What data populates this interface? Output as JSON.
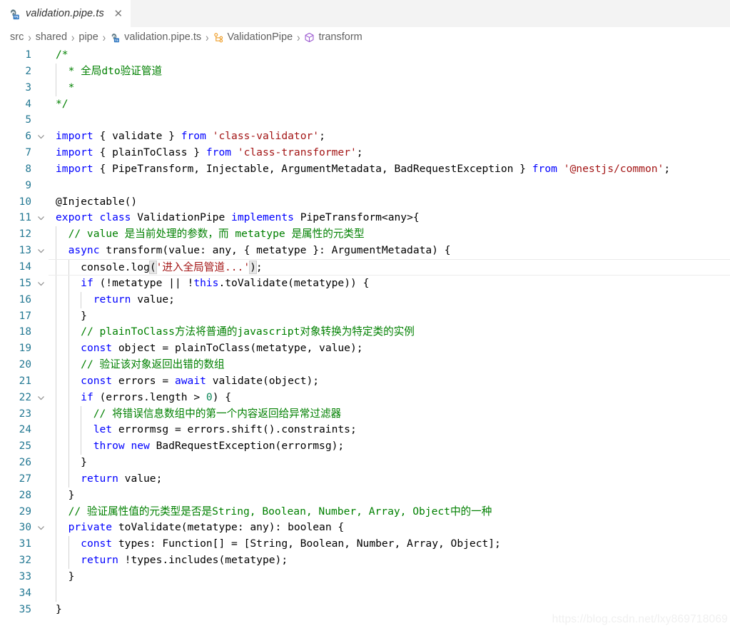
{
  "window": {
    "background": "#ffffff",
    "tabbar_background": "#f3f3f3"
  },
  "tab": {
    "label": "validation.pipe.ts",
    "icon": "nestjs-typescript-file-icon",
    "close_label": "✕",
    "active": true
  },
  "breadcrumb": {
    "separator": "›",
    "items": [
      {
        "label": "src",
        "icon": null
      },
      {
        "label": "shared",
        "icon": null
      },
      {
        "label": "pipe",
        "icon": null
      },
      {
        "label": "validation.pipe.ts",
        "icon": "nestjs-typescript-file-icon"
      },
      {
        "label": "ValidationPipe",
        "icon": "class-symbol-icon"
      },
      {
        "label": "transform",
        "icon": "method-symbol-icon"
      }
    ]
  },
  "editor": {
    "language": "typescript",
    "current_line": 14,
    "colors": {
      "keyword": "#0000ff",
      "string": "#a31515",
      "comment": "#008000",
      "number": "#098658",
      "plain": "#000000",
      "line_number": "#237893",
      "indent_guide": "#d3d3d3",
      "current_line_border": "#ebebeb",
      "bracket_match": "#e7e7e7"
    },
    "lines": [
      {
        "n": 1,
        "fold": false,
        "indent": 0,
        "tokens": [
          {
            "t": "/*",
            "c": "com"
          }
        ]
      },
      {
        "n": 2,
        "fold": false,
        "indent": 1,
        "tokens": [
          {
            "t": "* 全局dto验证管道",
            "c": "com"
          }
        ]
      },
      {
        "n": 3,
        "fold": false,
        "indent": 1,
        "tokens": [
          {
            "t": "*",
            "c": "com"
          }
        ]
      },
      {
        "n": 4,
        "fold": false,
        "indent": 0,
        "tokens": [
          {
            "t": "*/",
            "c": "com"
          }
        ]
      },
      {
        "n": 5,
        "fold": false,
        "indent": 0,
        "tokens": []
      },
      {
        "n": 6,
        "fold": true,
        "indent": 0,
        "tokens": [
          {
            "t": "import",
            "c": "key"
          },
          {
            "t": " { validate } ",
            "c": "plain"
          },
          {
            "t": "from",
            "c": "key"
          },
          {
            "t": " ",
            "c": "plain"
          },
          {
            "t": "'class-validator'",
            "c": "str"
          },
          {
            "t": ";",
            "c": "plain"
          }
        ]
      },
      {
        "n": 7,
        "fold": false,
        "indent": 0,
        "tokens": [
          {
            "t": "import",
            "c": "key"
          },
          {
            "t": " { plainToClass } ",
            "c": "plain"
          },
          {
            "t": "from",
            "c": "key"
          },
          {
            "t": " ",
            "c": "plain"
          },
          {
            "t": "'class-transformer'",
            "c": "str"
          },
          {
            "t": ";",
            "c": "plain"
          }
        ]
      },
      {
        "n": 8,
        "fold": false,
        "indent": 0,
        "tokens": [
          {
            "t": "import",
            "c": "key"
          },
          {
            "t": " { PipeTransform, Injectable, ArgumentMetadata, BadRequestException } ",
            "c": "plain"
          },
          {
            "t": "from",
            "c": "key"
          },
          {
            "t": " ",
            "c": "plain"
          },
          {
            "t": "'@nestjs/common'",
            "c": "str"
          },
          {
            "t": ";",
            "c": "plain"
          }
        ]
      },
      {
        "n": 9,
        "fold": false,
        "indent": 0,
        "tokens": []
      },
      {
        "n": 10,
        "fold": false,
        "indent": 0,
        "tokens": [
          {
            "t": "@Injectable()",
            "c": "plain"
          }
        ]
      },
      {
        "n": 11,
        "fold": true,
        "indent": 0,
        "tokens": [
          {
            "t": "export",
            "c": "key"
          },
          {
            "t": " ",
            "c": "plain"
          },
          {
            "t": "class",
            "c": "key"
          },
          {
            "t": " ValidationPipe ",
            "c": "plain"
          },
          {
            "t": "implements",
            "c": "key"
          },
          {
            "t": " PipeTransform<any>{",
            "c": "plain"
          }
        ]
      },
      {
        "n": 12,
        "fold": false,
        "indent": 1,
        "tokens": [
          {
            "t": "// value 是当前处理的参数，而 metatype 是属性的元类型",
            "c": "com"
          }
        ]
      },
      {
        "n": 13,
        "fold": true,
        "indent": 1,
        "tokens": [
          {
            "t": "async",
            "c": "key"
          },
          {
            "t": " transform(value: any, { metatype }: ArgumentMetadata) {",
            "c": "plain"
          }
        ]
      },
      {
        "n": 14,
        "fold": false,
        "indent": 2,
        "tokens": [
          {
            "t": "console.log",
            "c": "plain"
          },
          {
            "t": "(",
            "c": "plain",
            "hl": true
          },
          {
            "t": "'进入全局管道...'",
            "c": "str"
          },
          {
            "t": ")",
            "c": "plain",
            "hl": true
          },
          {
            "t": ";",
            "c": "plain"
          }
        ]
      },
      {
        "n": 15,
        "fold": true,
        "indent": 2,
        "tokens": [
          {
            "t": "if",
            "c": "key"
          },
          {
            "t": " (!metatype || !",
            "c": "plain"
          },
          {
            "t": "this",
            "c": "key"
          },
          {
            "t": ".toValidate(metatype)) {",
            "c": "plain"
          }
        ]
      },
      {
        "n": 16,
        "fold": false,
        "indent": 3,
        "tokens": [
          {
            "t": "return",
            "c": "key"
          },
          {
            "t": " value;",
            "c": "plain"
          }
        ]
      },
      {
        "n": 17,
        "fold": false,
        "indent": 2,
        "tokens": [
          {
            "t": "}",
            "c": "plain"
          }
        ]
      },
      {
        "n": 18,
        "fold": false,
        "indent": 2,
        "tokens": [
          {
            "t": "// plainToClass方法将普通的javascript对象转换为特定类的实例",
            "c": "com"
          }
        ]
      },
      {
        "n": 19,
        "fold": false,
        "indent": 2,
        "tokens": [
          {
            "t": "const",
            "c": "key"
          },
          {
            "t": " object = plainToClass(metatype, value);",
            "c": "plain"
          }
        ]
      },
      {
        "n": 20,
        "fold": false,
        "indent": 2,
        "tokens": [
          {
            "t": "// 验证该对象返回出错的数组",
            "c": "com"
          }
        ]
      },
      {
        "n": 21,
        "fold": false,
        "indent": 2,
        "tokens": [
          {
            "t": "const",
            "c": "key"
          },
          {
            "t": " errors = ",
            "c": "plain"
          },
          {
            "t": "await",
            "c": "key"
          },
          {
            "t": " validate(object);",
            "c": "plain"
          }
        ]
      },
      {
        "n": 22,
        "fold": true,
        "indent": 2,
        "tokens": [
          {
            "t": "if",
            "c": "key"
          },
          {
            "t": " (errors.length > ",
            "c": "plain"
          },
          {
            "t": "0",
            "c": "num"
          },
          {
            "t": ") {",
            "c": "plain"
          }
        ]
      },
      {
        "n": 23,
        "fold": false,
        "indent": 3,
        "tokens": [
          {
            "t": "// 将错误信息数组中的第一个内容返回给异常过滤器",
            "c": "com"
          }
        ]
      },
      {
        "n": 24,
        "fold": false,
        "indent": 3,
        "tokens": [
          {
            "t": "let",
            "c": "key"
          },
          {
            "t": " errormsg = errors.shift().constraints;",
            "c": "plain"
          }
        ]
      },
      {
        "n": 25,
        "fold": false,
        "indent": 3,
        "tokens": [
          {
            "t": "throw",
            "c": "key"
          },
          {
            "t": " ",
            "c": "plain"
          },
          {
            "t": "new",
            "c": "key"
          },
          {
            "t": " BadRequestException(errormsg);",
            "c": "plain"
          }
        ]
      },
      {
        "n": 26,
        "fold": false,
        "indent": 2,
        "tokens": [
          {
            "t": "}",
            "c": "plain"
          }
        ]
      },
      {
        "n": 27,
        "fold": false,
        "indent": 2,
        "tokens": [
          {
            "t": "return",
            "c": "key"
          },
          {
            "t": " value;",
            "c": "plain"
          }
        ]
      },
      {
        "n": 28,
        "fold": false,
        "indent": 1,
        "tokens": [
          {
            "t": "}",
            "c": "plain"
          }
        ]
      },
      {
        "n": 29,
        "fold": false,
        "indent": 1,
        "tokens": [
          {
            "t": "// 验证属性值的元类型是否是String, Boolean, Number, Array, Object中的一种",
            "c": "com"
          }
        ]
      },
      {
        "n": 30,
        "fold": true,
        "indent": 1,
        "tokens": [
          {
            "t": "private",
            "c": "key"
          },
          {
            "t": " toValidate(metatype: any): boolean {",
            "c": "plain"
          }
        ]
      },
      {
        "n": 31,
        "fold": false,
        "indent": 2,
        "tokens": [
          {
            "t": "const",
            "c": "key"
          },
          {
            "t": " types: Function[] = [String, Boolean, Number, Array, Object];",
            "c": "plain"
          }
        ]
      },
      {
        "n": 32,
        "fold": false,
        "indent": 2,
        "tokens": [
          {
            "t": "return",
            "c": "key"
          },
          {
            "t": " !types.includes(metatype);",
            "c": "plain"
          }
        ]
      },
      {
        "n": 33,
        "fold": false,
        "indent": 1,
        "tokens": [
          {
            "t": "}",
            "c": "plain"
          }
        ]
      },
      {
        "n": 34,
        "fold": false,
        "indent": 1,
        "tokens": []
      },
      {
        "n": 35,
        "fold": false,
        "indent": 0,
        "tokens": [
          {
            "t": "}",
            "c": "plain"
          }
        ]
      }
    ]
  },
  "watermark": {
    "text": "https://blog.csdn.net/lxy869718069"
  }
}
